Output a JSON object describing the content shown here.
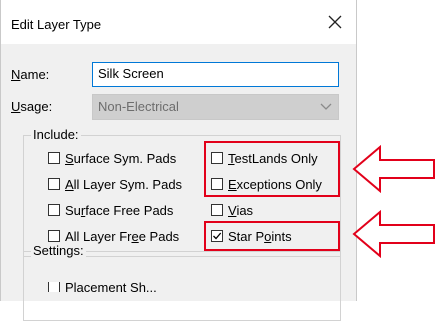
{
  "dialog": {
    "title": "Edit Layer Type",
    "name_label_prefix": "N",
    "name_label_rest": "ame:",
    "name_value": "Silk Screen",
    "usage_label_prefix": "U",
    "usage_label_rest": "sage:",
    "usage_value": "Non-Electrical",
    "include_label": "Include:",
    "settings_label": "Settings:",
    "partial_bottom_label": "Placement Sh..."
  },
  "checkboxes": [
    {
      "pre": "",
      "ul": "S",
      "post": "urface Sym. Pads",
      "checked": false
    },
    {
      "pre": "",
      "ul": "A",
      "post": "ll Layer Sym. Pads",
      "checked": false
    },
    {
      "pre": "Su",
      "ul": "r",
      "post": "face Free Pads",
      "checked": false
    },
    {
      "pre": "All Layer Fr",
      "ul": "e",
      "post": "e Pads",
      "checked": false
    },
    {
      "pre": "",
      "ul": "T",
      "post": "estLands Only",
      "checked": false
    },
    {
      "pre": "",
      "ul": "E",
      "post": "xceptions Only",
      "checked": false
    },
    {
      "pre": "",
      "ul": "V",
      "post": "ias",
      "checked": false
    },
    {
      "pre": "Star P",
      "ul": "o",
      "post": "ints",
      "checked": true
    }
  ],
  "colors": {
    "highlight": "#e2001a",
    "accent": "#0078d7"
  }
}
